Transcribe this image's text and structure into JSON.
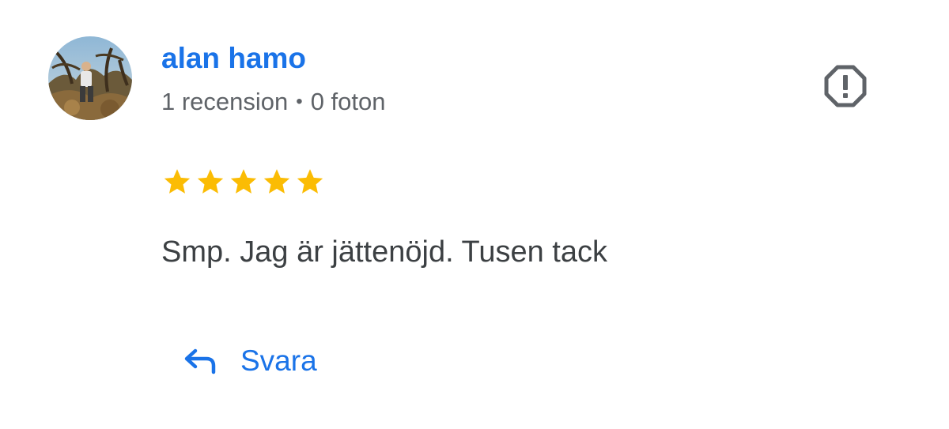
{
  "review": {
    "reviewer": {
      "name": "alan hamo",
      "review_count": "1 recension",
      "separator": "•",
      "photo_count": "0 foton"
    },
    "rating": {
      "stars": 5,
      "max_stars": 5,
      "star_color": "#fbbc04"
    },
    "text": "Smp. Jag är jättenöjd. Tusen tack",
    "actions": {
      "reply_label": "Svara"
    },
    "icons": {
      "report": "report-flag-octagon-icon",
      "reply": "reply-arrow-icon"
    },
    "colors": {
      "link": "#1a73e8",
      "meta": "#5f6368",
      "body": "#3c4043",
      "icon": "#5f6368"
    }
  }
}
